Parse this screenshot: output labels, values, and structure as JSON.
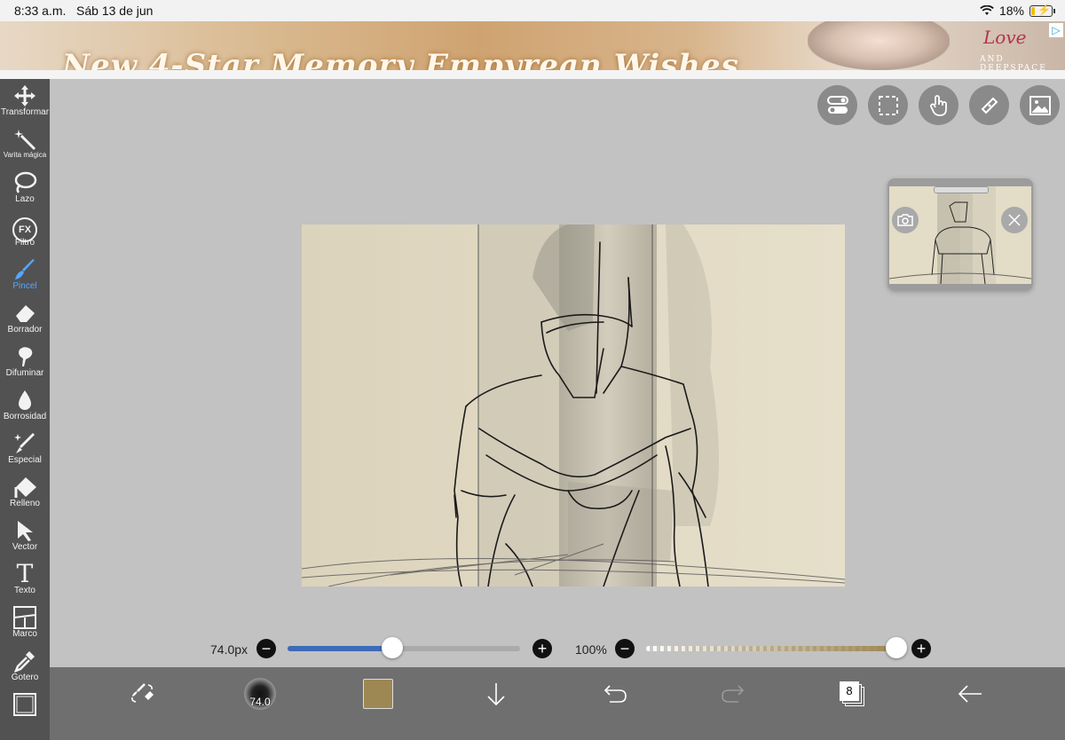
{
  "status": {
    "time": "8:33 a.m.",
    "date": "Sáb 13 de jun",
    "battery": "18%",
    "wifi_icon": "wifi-icon"
  },
  "ad": {
    "headline": "New 4-Star Memory Empyrean Wishes",
    "brand": "Love",
    "brand_sub": "AND DEEPSPACE",
    "badge": "▷"
  },
  "toolbar": {
    "items": [
      {
        "label": "Transformar",
        "icon": "move-icon"
      },
      {
        "label": "Varita mágica",
        "icon": "magic-wand-icon"
      },
      {
        "label": "Lazo",
        "icon": "lasso-icon"
      },
      {
        "label": "Filtro",
        "icon": "fx-icon",
        "glyph": "FX"
      },
      {
        "label": "Pincel",
        "icon": "brush-icon",
        "active": true
      },
      {
        "label": "Borrador",
        "icon": "eraser-icon"
      },
      {
        "label": "Difuminar",
        "icon": "smudge-icon"
      },
      {
        "label": "Borrosidad",
        "icon": "blur-drop-icon"
      },
      {
        "label": "Especial",
        "icon": "sparkle-pen-icon"
      },
      {
        "label": "Relleno",
        "icon": "fill-bucket-icon"
      },
      {
        "label": "Vector",
        "icon": "vector-arrow-icon"
      },
      {
        "label": "Texto",
        "icon": "text-icon",
        "glyph": "T"
      },
      {
        "label": "Marco",
        "icon": "frame-icon"
      },
      {
        "label": "Gotero",
        "icon": "eyedropper-icon"
      },
      {
        "label": "",
        "icon": "canvas-icon"
      }
    ]
  },
  "top_buttons": [
    "toggle-icon",
    "selection-icon",
    "hand-icon",
    "ruler-icon",
    "image-icon"
  ],
  "brush": {
    "size_label": "74.0px",
    "size_fraction": 0.45,
    "opacity_label": "100%",
    "opacity_fraction": 1.0,
    "preview_value": "74.0"
  },
  "colors": {
    "current": "#9d8752",
    "slider_fill": "#3d6bb8",
    "active_tool": "#58a6ff"
  },
  "bottom": {
    "layers_count": "8"
  }
}
